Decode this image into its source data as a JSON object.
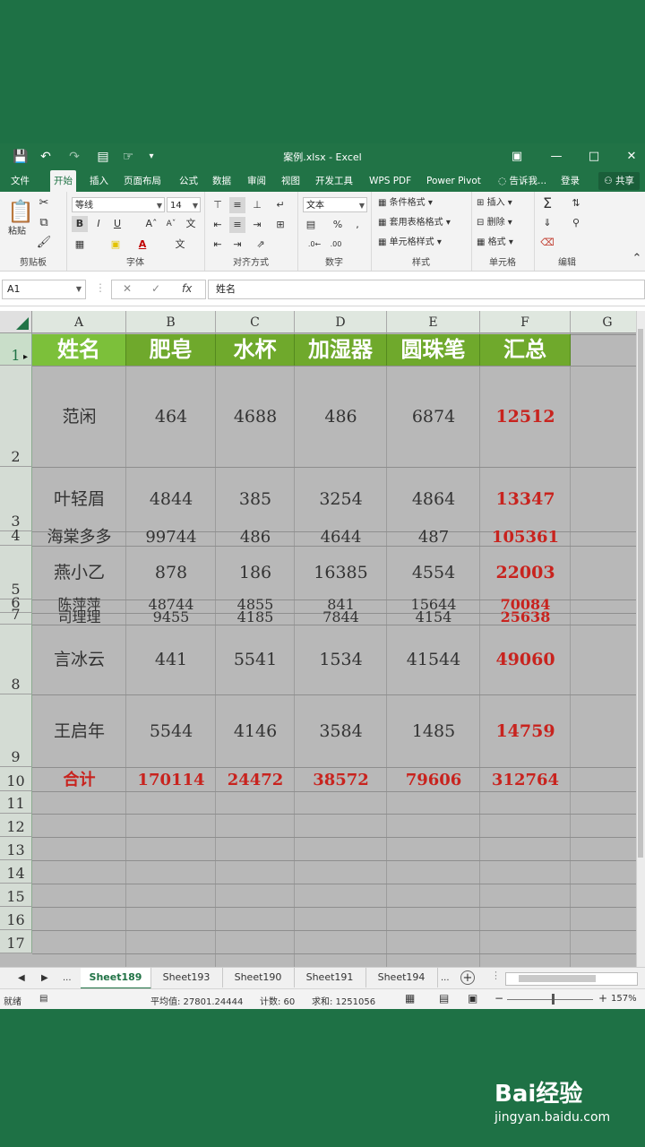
{
  "window": {
    "title": "案例.xlsx - Excel",
    "quick_access": [
      "save-icon",
      "undo-icon",
      "redo-icon",
      "print-preview-icon",
      "touch-mode-icon",
      "customize-icon"
    ],
    "controls": [
      "ribbon-display-icon",
      "minimize-icon",
      "maximize-icon",
      "close-icon"
    ]
  },
  "menu": {
    "tabs": [
      "文件",
      "开始",
      "插入",
      "页面布局",
      "公式",
      "数据",
      "审阅",
      "视图",
      "开发工具",
      "WPS PDF",
      "Power Pivot"
    ],
    "active": "开始",
    "tell_me": "告诉我...",
    "login": "登录",
    "share": "共享"
  },
  "ribbon": {
    "groups": [
      "剪贴板",
      "字体",
      "对齐方式",
      "数字",
      "样式",
      "单元格",
      "编辑"
    ],
    "paste_label": "粘贴",
    "font_name": "等线",
    "font_size": "14",
    "number_format": "文本",
    "style_buttons": [
      "条件格式",
      "套用表格格式",
      "单元格样式"
    ],
    "cell_buttons": [
      "插入",
      "删除",
      "格式"
    ]
  },
  "formula_bar": {
    "name_box": "A1",
    "formula": "姓名"
  },
  "sheet": {
    "columns": [
      "A",
      "B",
      "C",
      "D",
      "E",
      "F",
      "G"
    ],
    "row_numbers": [
      "1",
      "2",
      "3",
      "4",
      "5",
      "6",
      "7",
      "8",
      "9",
      "10",
      "11",
      "12",
      "13",
      "14",
      "15",
      "16",
      "17"
    ],
    "headers": [
      "姓名",
      "肥皂",
      "水杯",
      "加湿器",
      "圆珠笔",
      "汇总"
    ],
    "rows": [
      [
        "范闲",
        "464",
        "4688",
        "486",
        "6874",
        "12512"
      ],
      [
        "叶轻眉",
        "4844",
        "385",
        "3254",
        "4864",
        "13347"
      ],
      [
        "海棠多多",
        "99744",
        "486",
        "4644",
        "487",
        "105361"
      ],
      [
        "燕小乙",
        "878",
        "186",
        "16385",
        "4554",
        "22003"
      ],
      [
        "陈萍萍",
        "48744",
        "4855",
        "841",
        "15644",
        "70084"
      ],
      [
        "司理理",
        "9455",
        "4185",
        "7844",
        "4154",
        "25638"
      ],
      [
        "言冰云",
        "441",
        "5541",
        "1534",
        "41544",
        "49060"
      ],
      [
        "王启年",
        "5544",
        "4146",
        "3584",
        "1485",
        "14759"
      ]
    ],
    "totals": [
      "合计",
      "170114",
      "24472",
      "38572",
      "79606",
      "312764"
    ]
  },
  "sheet_tabs": {
    "items": [
      "Sheet189",
      "Sheet193",
      "Sheet190",
      "Sheet191",
      "Sheet194"
    ],
    "active": "Sheet189",
    "more": "..."
  },
  "status_bar": {
    "mode": "就绪",
    "average": "平均值: 27801.24444",
    "count": "计数: 60",
    "sum": "求和: 1251056",
    "zoom": "157%"
  },
  "watermark": {
    "logo": "Bai经验",
    "url": "jingyan.baidu.com"
  },
  "colors": {
    "excel_green": "#217346",
    "header_fill": "#6fa92c",
    "summary_red": "#c8231e"
  }
}
